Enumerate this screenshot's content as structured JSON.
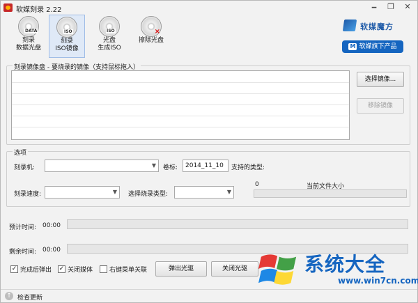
{
  "window": {
    "title": "软媒刻录 2.22",
    "controls": [
      "🗕",
      "❐",
      "✕"
    ]
  },
  "toolbar": {
    "items": [
      {
        "tag": "DATA",
        "label1": "刻录",
        "label2": "数据光盘",
        "icon": "data-disc-icon"
      },
      {
        "tag": "ISO",
        "label1": "刻录",
        "label2": "ISO镜像",
        "icon": "iso-disc-icon"
      },
      {
        "tag": "ISO",
        "label1": "光盘",
        "label2": "生成ISO",
        "icon": "make-iso-disc-icon"
      },
      {
        "tag": "",
        "label1": "擦除光盘",
        "label2": "",
        "icon": "erase-disc-icon"
      }
    ],
    "active_index": 1,
    "brand": "软媒魔方",
    "products_button": "软媒旗下产品",
    "products_badge": "M"
  },
  "image_group": {
    "title": "刻录镜像盘 - 要烧录的镜像（支持鼠标拖入）",
    "select_button": "选择镜像...",
    "remove_button": "移除镜像"
  },
  "options": {
    "title": "选项",
    "burner_label": "刻录机:",
    "volume_label": "卷标:",
    "volume_value": "2014_11_10",
    "supported_types_label": "支持的类型:",
    "speed_label": "刻录速度:",
    "burn_type_label": "选择烧录类型:",
    "size_value": "0",
    "current_size_label": "当前文件大小"
  },
  "progress": {
    "estimated_label": "预计时间:",
    "estimated_value": "00:00",
    "remaining_label": "剩余时间:",
    "remaining_value": "00:00"
  },
  "bottom": {
    "eject_after": {
      "label": "完成后弹出",
      "checked": true
    },
    "close_media": {
      "label": "关闭媒体",
      "checked": true
    },
    "context_menu": {
      "label": "右键菜单关联",
      "checked": false
    },
    "eject_button": "弹出光驱",
    "close_button": "关闭光驱"
  },
  "status": {
    "check_update": "检查更新"
  },
  "watermark": {
    "title": "系统大全",
    "url": "www.win7cn.com"
  },
  "colors": {
    "accent": "#1565c0",
    "active_tab": "#dfe9f7"
  }
}
